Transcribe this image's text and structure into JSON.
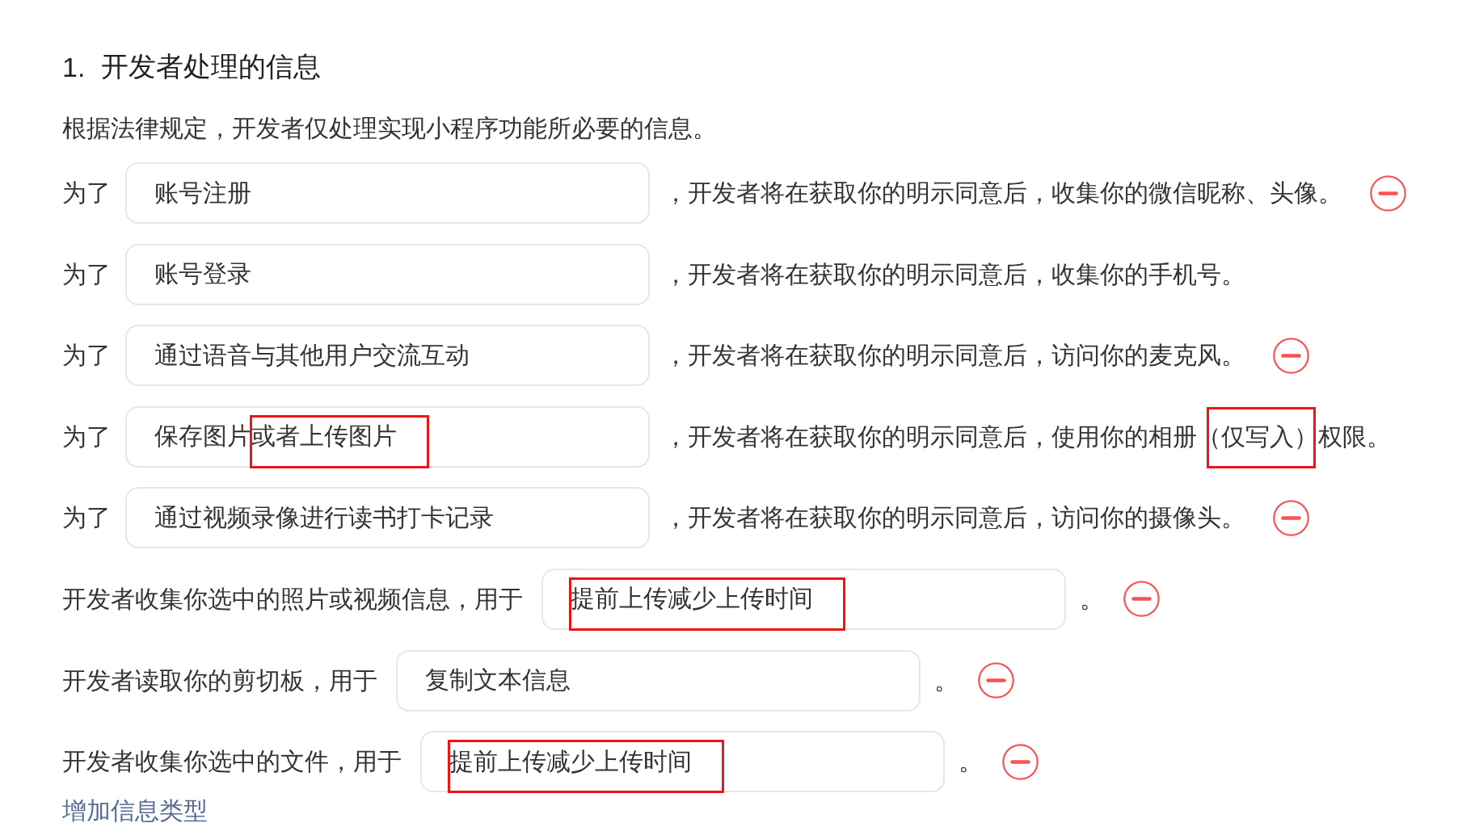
{
  "section": {
    "number": "1.",
    "title": "开发者处理的信息",
    "intro": "根据法律规定，开发者仅处理实现小程序功能所必要的信息。"
  },
  "items": [
    {
      "kind": "purpose",
      "label": "为了",
      "value_parts": [
        {
          "text": "账号注册",
          "marked": false
        }
      ],
      "sentence_parts": [
        {
          "text": "，开发者将在获取你的明示同意后，收集你的微信昵称、头像。",
          "marked": false
        }
      ],
      "removable": true
    },
    {
      "kind": "purpose",
      "label": "为了",
      "value_parts": [
        {
          "text": "账号登录",
          "marked": false
        }
      ],
      "sentence_parts": [
        {
          "text": "，开发者将在获取你的明示同意后，收集你的手机号。",
          "marked": false
        }
      ],
      "removable": false
    },
    {
      "kind": "purpose",
      "label": "为了",
      "value_parts": [
        {
          "text": "通过语音与其他用户交流互动",
          "marked": false
        }
      ],
      "sentence_parts": [
        {
          "text": "，开发者将在获取你的明示同意后，访问你的麦克风。",
          "marked": false
        }
      ],
      "removable": true
    },
    {
      "kind": "purpose",
      "label": "为了",
      "value_parts": [
        {
          "text": "保存图片",
          "marked": false
        },
        {
          "text": "或者上传图片",
          "marked": true
        }
      ],
      "sentence_parts": [
        {
          "text": "，开发者将在获取你的明示同意后，使用你的相册",
          "marked": false
        },
        {
          "text": "（仅写入）",
          "marked": true
        },
        {
          "text": "权限。",
          "marked": false
        }
      ],
      "removable": false
    },
    {
      "kind": "purpose",
      "label": "为了",
      "value_parts": [
        {
          "text": "通过视频录像进行读书打卡记录",
          "marked": false
        }
      ],
      "sentence_parts": [
        {
          "text": "，开发者将在获取你的明示同意后，访问你的摄像头。",
          "marked": false
        }
      ],
      "removable": true
    },
    {
      "kind": "usage",
      "label": "开发者收集你选中的照片或视频信息，用于",
      "value_parts": [
        {
          "text": "提前上传减少上传时间",
          "marked": true
        }
      ],
      "sentence_parts": [
        {
          "text": "。",
          "marked": false
        }
      ],
      "removable": true
    },
    {
      "kind": "usage",
      "label": "开发者读取你的剪切板，用于",
      "value_parts": [
        {
          "text": "复制文本信息",
          "marked": false
        }
      ],
      "sentence_parts": [
        {
          "text": "。",
          "marked": false
        }
      ],
      "removable": true
    },
    {
      "kind": "usage",
      "label": "开发者收集你选中的文件，用于",
      "value_parts": [
        {
          "text": "提前上传减少上传时间",
          "marked": true
        }
      ],
      "sentence_parts": [
        {
          "text": "。",
          "marked": false
        }
      ],
      "removable": true
    }
  ],
  "add_link": "增加信息类型"
}
